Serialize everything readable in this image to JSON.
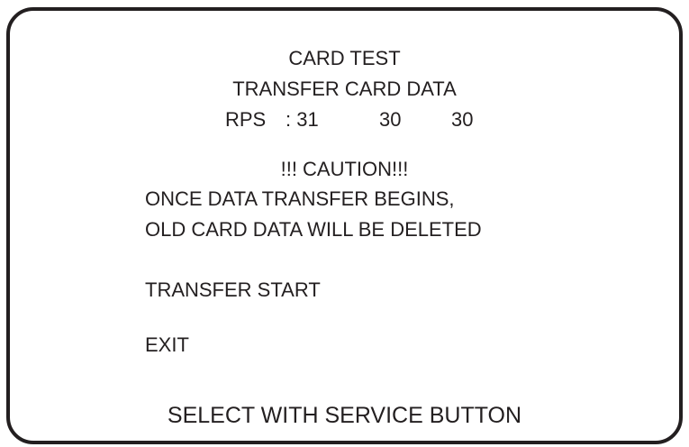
{
  "screen": {
    "title": "CARD TEST",
    "subtitle": "TRANSFER CARD DATA",
    "rps": {
      "label": "RPS",
      "separator": ": 31",
      "value_2": "30",
      "value_3": "30"
    },
    "caution": {
      "heading": "!!! CAUTION!!!",
      "line_1": "ONCE DATA TRANSFER BEGINS,",
      "line_2": "OLD CARD DATA WILL BE DELETED"
    },
    "menu": {
      "transfer_start": "TRANSFER START",
      "exit": "EXIT"
    },
    "footer": "SELECT WITH SERVICE BUTTON"
  }
}
